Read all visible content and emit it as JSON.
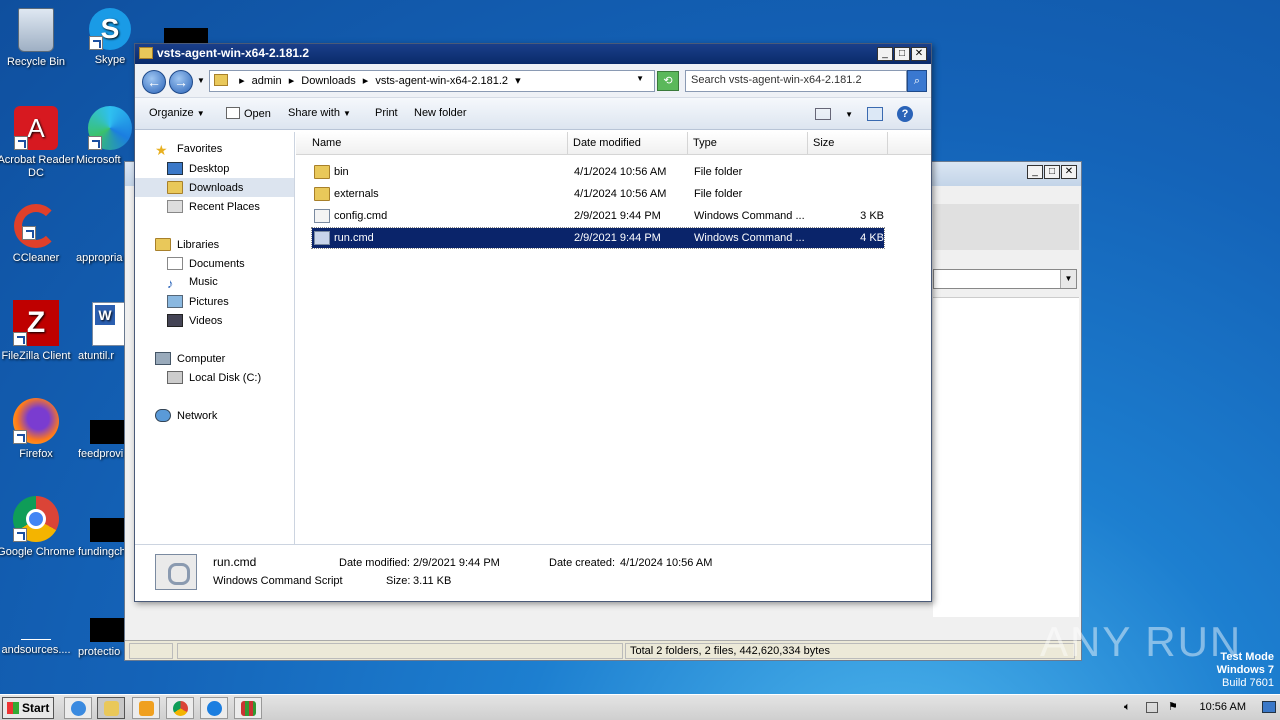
{
  "desktop": {
    "icons": [
      {
        "label": "Recycle Bin"
      },
      {
        "label": "Skype"
      },
      {
        "label": "Acrobat Reader DC"
      },
      {
        "label": "Microsoft"
      },
      {
        "label": "CCleaner"
      },
      {
        "label": "appropria"
      },
      {
        "label": "FileZilla Client"
      },
      {
        "label": "atuntil.r"
      },
      {
        "label": "Firefox"
      },
      {
        "label": "feedprovi"
      },
      {
        "label": "Google Chrome"
      },
      {
        "label": "fundingch"
      },
      {
        "label": "andsources...."
      },
      {
        "label": "protectio"
      }
    ]
  },
  "window": {
    "title": "vsts-agent-win-x64-2.181.2"
  },
  "address": {
    "crumbs": [
      "admin",
      "Downloads",
      "vsts-agent-win-x64-2.181.2"
    ],
    "search_placeholder": "Search vsts-agent-win-x64-2.181.2"
  },
  "toolbar": {
    "organize": "Organize",
    "open": "Open",
    "share": "Share with",
    "print": "Print",
    "new_folder": "New folder"
  },
  "nav": {
    "favorites": "Favorites",
    "desktop": "Desktop",
    "downloads": "Downloads",
    "recent": "Recent Places",
    "libraries": "Libraries",
    "documents": "Documents",
    "music": "Music",
    "pictures": "Pictures",
    "videos": "Videos",
    "computer": "Computer",
    "local_disk": "Local Disk (C:)",
    "network": "Network"
  },
  "columns": {
    "name": "Name",
    "date": "Date modified",
    "type": "Type",
    "size": "Size"
  },
  "files": [
    {
      "name": "bin",
      "date": "4/1/2024 10:56 AM",
      "type": "File folder",
      "size": ""
    },
    {
      "name": "externals",
      "date": "4/1/2024 10:56 AM",
      "type": "File folder",
      "size": ""
    },
    {
      "name": "config.cmd",
      "date": "2/9/2021 9:44 PM",
      "type": "Windows Command ...",
      "size": "3 KB"
    },
    {
      "name": "run.cmd",
      "date": "2/9/2021 9:44 PM",
      "type": "Windows Command ...",
      "size": "4 KB"
    }
  ],
  "details": {
    "name": "run.cmd",
    "kind": "Windows Command Script",
    "modified_label": "Date modified:",
    "modified": "2/9/2021 9:44 PM",
    "created_label": "Date created:",
    "created": "4/1/2024 10:56 AM",
    "size_label": "Size:",
    "size": "3.11 KB"
  },
  "bg_status": "Total 2 folders, 2 files, 442,620,334 bytes",
  "taskbar": {
    "start": "Start",
    "clock": "10:56 AM"
  },
  "watermark": {
    "line1": "Test Mode",
    "line2": "Windows 7",
    "line3": "Build 7601",
    "anyrun": "ANY RUN"
  }
}
